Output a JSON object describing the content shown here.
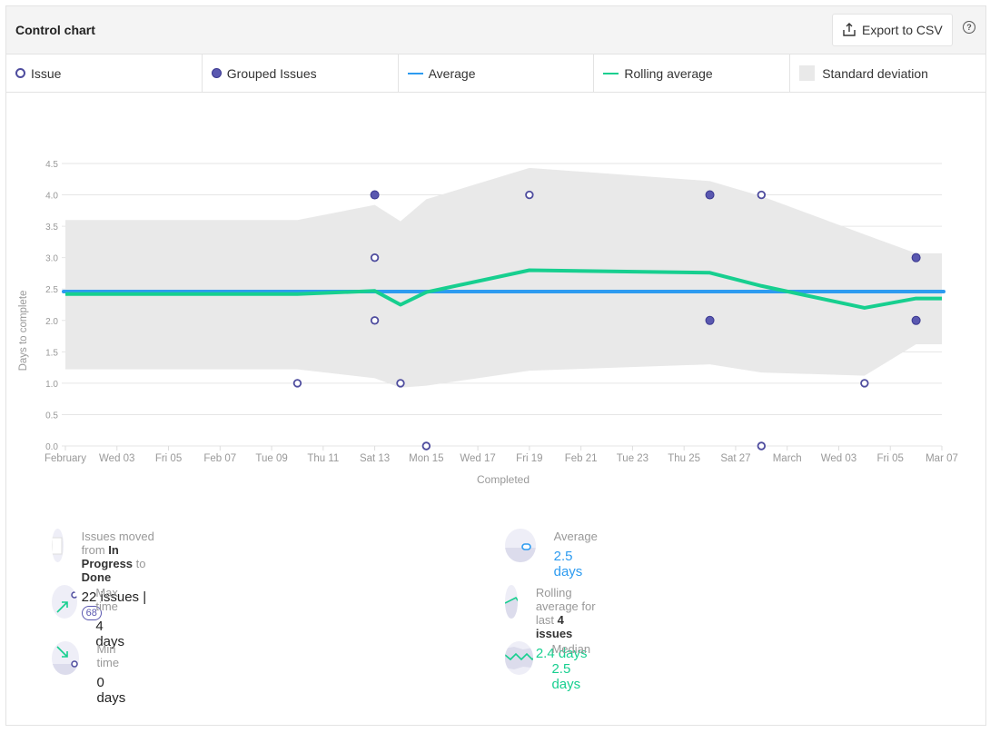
{
  "header": {
    "title": "Control chart",
    "export_label": "Export to CSV",
    "help": "?"
  },
  "legend": [
    {
      "label": "Issue"
    },
    {
      "label": "Grouped Issues"
    },
    {
      "label": "Average"
    },
    {
      "label": "Rolling average"
    },
    {
      "label": "Standard deviation"
    }
  ],
  "colors": {
    "issue": "#4e4c9e",
    "grouped": "#5a58b0",
    "average": "#2d9bf0",
    "rolling": "#17cf8f",
    "std": "#e9e9e9"
  },
  "chart_data": {
    "type": "scatter",
    "xlabel": "Completed",
    "ylabel": "Days to complete",
    "xlim": [
      "Feb 01",
      "Mar 07"
    ],
    "ylim": [
      0,
      4.5
    ],
    "grid": true,
    "yticks": [
      "0.0",
      "0.5",
      "1.0",
      "1.5",
      "2.0",
      "2.5",
      "3.0",
      "3.5",
      "4.0",
      "4.5"
    ],
    "xticks": [
      {
        "date": "Feb 01",
        "label": "February"
      },
      {
        "date": "Feb 03",
        "label": "Wed 03"
      },
      {
        "date": "Feb 05",
        "label": "Fri 05"
      },
      {
        "date": "Feb 07",
        "label": "Feb 07"
      },
      {
        "date": "Feb 09",
        "label": "Tue 09"
      },
      {
        "date": "Feb 11",
        "label": "Thu 11"
      },
      {
        "date": "Feb 13",
        "label": "Sat 13"
      },
      {
        "date": "Feb 15",
        "label": "Mon 15"
      },
      {
        "date": "Feb 17",
        "label": "Wed 17"
      },
      {
        "date": "Feb 19",
        "label": "Fri 19"
      },
      {
        "date": "Feb 21",
        "label": "Feb 21"
      },
      {
        "date": "Feb 23",
        "label": "Tue 23"
      },
      {
        "date": "Feb 25",
        "label": "Thu 25"
      },
      {
        "date": "Feb 27",
        "label": "Sat 27"
      },
      {
        "date": "Mar 01",
        "label": "March"
      },
      {
        "date": "Mar 03",
        "label": "Wed 03"
      },
      {
        "date": "Mar 05",
        "label": "Fri 05"
      },
      {
        "date": "Mar 07",
        "label": "Mar 07"
      }
    ],
    "issues": [
      [
        "Feb 10",
        1.0
      ],
      [
        "Feb 13",
        3.0
      ],
      [
        "Feb 13",
        2.0
      ],
      [
        "Feb 14",
        1.0
      ],
      [
        "Feb 15",
        0.0
      ],
      [
        "Feb 19",
        4.0
      ],
      [
        "Feb 28",
        4.0
      ],
      [
        "Feb 28",
        0.0
      ],
      [
        "Mar 04",
        1.0
      ]
    ],
    "grouped_issues": [
      [
        "Feb 13",
        4.0
      ],
      [
        "Feb 26",
        4.0
      ],
      [
        "Feb 26",
        2.0
      ],
      [
        "Mar 06",
        3.0
      ],
      [
        "Mar 06",
        2.0
      ]
    ],
    "average": 2.46,
    "rolling_average": [
      [
        "Feb 01",
        2.42
      ],
      [
        "Feb 10",
        2.42
      ],
      [
        "Feb 13",
        2.47
      ],
      [
        "Feb 14",
        2.25
      ],
      [
        "Feb 15",
        2.45
      ],
      [
        "Feb 19",
        2.8
      ],
      [
        "Feb 26",
        2.76
      ],
      [
        "Feb 28",
        2.55
      ],
      [
        "Mar 04",
        2.2
      ],
      [
        "Mar 06",
        2.35
      ],
      [
        "Mar 07",
        2.35
      ]
    ],
    "std_upper": [
      [
        "Feb 01",
        3.6
      ],
      [
        "Feb 10",
        3.6
      ],
      [
        "Feb 13",
        3.84
      ],
      [
        "Feb 14",
        3.58
      ],
      [
        "Feb 15",
        3.93
      ],
      [
        "Feb 19",
        4.43
      ],
      [
        "Feb 26",
        4.22
      ],
      [
        "Feb 28",
        3.98
      ],
      [
        "Mar 04",
        3.37
      ],
      [
        "Mar 06",
        3.07
      ],
      [
        "Mar 07",
        3.07
      ]
    ],
    "std_lower": [
      [
        "Feb 01",
        1.22
      ],
      [
        "Feb 10",
        1.22
      ],
      [
        "Feb 13",
        1.08
      ],
      [
        "Feb 14",
        0.93
      ],
      [
        "Feb 15",
        0.96
      ],
      [
        "Feb 19",
        1.2
      ],
      [
        "Feb 26",
        1.3
      ],
      [
        "Feb 28",
        1.17
      ],
      [
        "Mar 04",
        1.12
      ],
      [
        "Mar 06",
        1.62
      ],
      [
        "Mar 07",
        1.62
      ]
    ]
  },
  "stats": {
    "moved": {
      "prefix": "Issues moved from ",
      "from": "In Progress",
      "mid": " to ",
      "to": "Done",
      "value": "22 issues | ",
      "badge": "68"
    },
    "average": {
      "label": "Average",
      "value": "2.5 days"
    },
    "max": {
      "label": "Max time",
      "value": "4 days"
    },
    "rolling": {
      "prefix": "Rolling average for last ",
      "bold": "4 issues",
      "value": "2.4 days"
    },
    "min": {
      "label": "Min time",
      "value": "0 days"
    },
    "median": {
      "label": "Median",
      "value": "2.5 days"
    }
  }
}
